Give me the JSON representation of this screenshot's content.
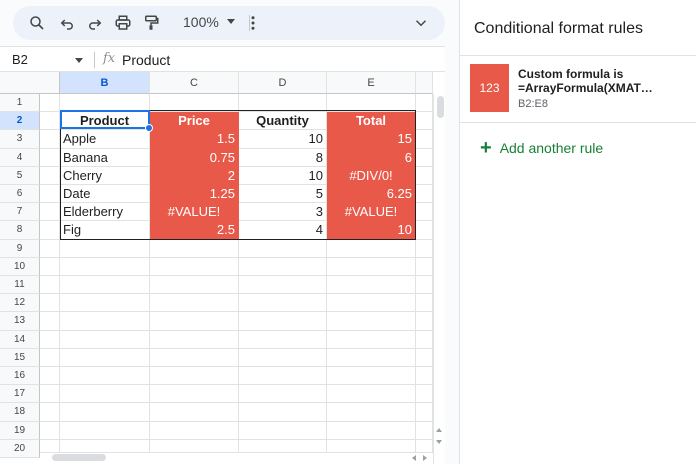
{
  "toolbar": {
    "zoom": "100%"
  },
  "formula_bar": {
    "name_box": "B2",
    "fx": "fx",
    "content": "Product"
  },
  "grid": {
    "columns": [
      "B",
      "C",
      "D",
      "E"
    ],
    "row_numbers": [
      "1",
      "2",
      "3",
      "4",
      "5",
      "6",
      "7",
      "8",
      "9",
      "10",
      "11",
      "12",
      "13",
      "14",
      "15",
      "16",
      "17",
      "18",
      "19",
      "20"
    ],
    "table": [
      [
        "Product",
        "Price",
        "Quantity",
        "Total"
      ],
      [
        "Apple",
        "1.5",
        "10",
        "15"
      ],
      [
        "Banana",
        "0.75",
        "8",
        "6"
      ],
      [
        "Cherry",
        "2",
        "10",
        "#DIV/0!"
      ],
      [
        "Date",
        "1.25",
        "5",
        "6.25"
      ],
      [
        "Elderberry",
        "#VALUE!",
        "3",
        "#VALUE!"
      ],
      [
        "Fig",
        "2.5",
        "4",
        "10"
      ]
    ],
    "highlight_color": "#e8594a"
  },
  "panel": {
    "title": "Conditional format rules",
    "rule": {
      "preview": "123",
      "line1": "Custom formula is",
      "line2": "=ArrayFormula(XMAT…",
      "range": "B2:E8"
    },
    "add_rule": "Add another rule",
    "add_color": "#188038"
  }
}
